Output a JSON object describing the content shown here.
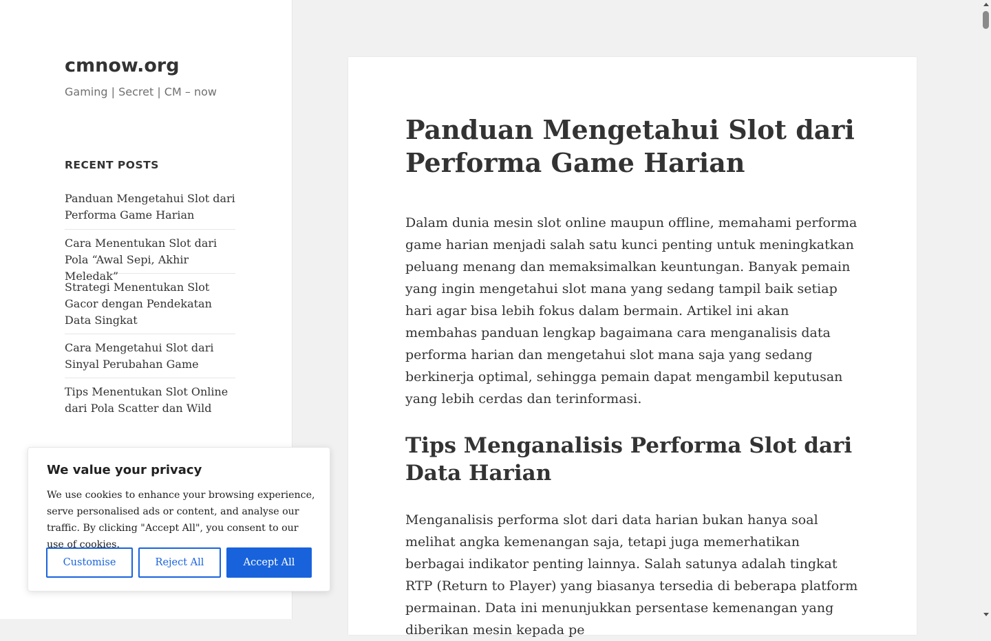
{
  "site": {
    "title": "cmnow.org",
    "description": "Gaming | Secret | CM – now"
  },
  "sidebar": {
    "widget_title": "RECENT POSTS",
    "recent_posts": [
      "Panduan Mengetahui Slot dari Performa Game Harian",
      "Cara Menentukan Slot dari Pola “Awal Sepi, Akhir Meledak”",
      "Strategi Menentukan Slot Gacor dengan Pendekatan Data Singkat",
      "Cara Mengetahui Slot dari Sinyal Perubahan Game",
      "Tips Menentukan Slot Online dari Pola Scatter dan Wild"
    ]
  },
  "article": {
    "title": "Panduan Mengetahui Slot dari Performa Game Harian",
    "paragraph1": "Dalam dunia mesin slot online maupun offline, memahami performa game harian menjadi salah satu kunci penting untuk meningkatkan peluang menang dan memaksimalkan keuntungan. Banyak pemain yang ingin mengetahui slot mana yang sedang tampil baik setiap hari agar bisa lebih fokus dalam bermain. Artikel ini akan membahas pand­uan lengkap bagaimana cara menganalisis data performa harian dan mengetahui slot mana saja yang sedang berkinerja optimal, sehingga pe­main dapat mengambil keputusan yang lebih cerdas dan terinformasi.",
    "heading2": "Tips Menganalisis Performa Slot dari Data Harian",
    "paragraph2": "Menganalisis performa slot dari data harian bukan hanya soal melihat angka kemenangan saja, tetapi juga memerhatikan berbagai indikator penting lainnya. Salah satunya adalah tingkat RTP (Return to Player) yang biasanya tersedia di beberapa platform permainan. Data ini me­nunjukkan persentase kemenangan yang diberikan mesin kepada pe­"
  },
  "cookie_banner": {
    "title": "We value your privacy",
    "text": "We use cookies to enhance your browsing experience, serve personalised ads or content, and analyse our traffic. By clicking \"Accept All\", you consent to our use of cookies.",
    "customise_label": "Customise",
    "reject_label": "Reject All",
    "accept_label": "Accept All",
    "accent_color": "#1863dc"
  }
}
